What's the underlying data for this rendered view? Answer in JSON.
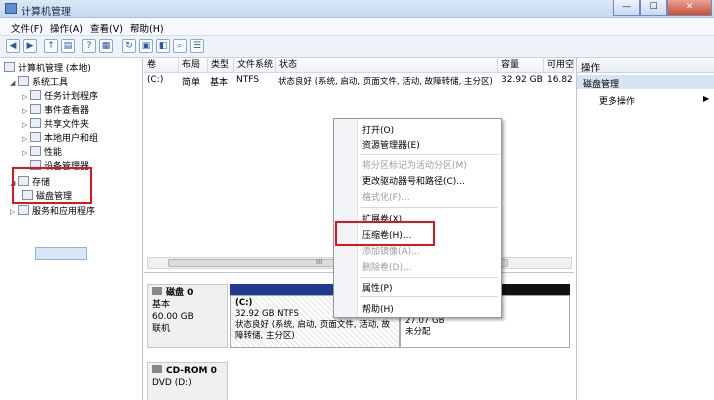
{
  "window": {
    "title": "计算机管理",
    "min": "—",
    "max": "☐",
    "close": "✕"
  },
  "menu": [
    "文件(F)",
    "操作(A)",
    "查看(V)",
    "帮助(H)"
  ],
  "tree": {
    "root": "计算机管理 (本地)",
    "system_tools": "系统工具",
    "task_scheduler": "任务计划程序",
    "event_viewer": "事件查看器",
    "shared_folders": "共享文件夹",
    "local_users": "本地用户和组",
    "performance": "性能",
    "device_manager": "设备管理器",
    "storage": "存储",
    "disk_management": "磁盘管理",
    "services_apps": "服务和应用程序"
  },
  "list": {
    "headers": [
      "卷",
      "布局",
      "类型",
      "文件系统",
      "状态",
      "容量",
      "可用空"
    ],
    "row": [
      "(C:)",
      "简单",
      "基本",
      "NTFS",
      "状态良好 (系统, 启动, 页面文件, 活动, 故障转储, 主分区)",
      "32.92 GB",
      "16.82"
    ],
    "scroll_mark": "III"
  },
  "disks": {
    "disk0": {
      "name": "磁盘 0",
      "type": "基本",
      "size": "60.00 GB",
      "status": "联机"
    },
    "c_part": {
      "label": "(C:)",
      "size": "32.92 GB NTFS",
      "status": "状态良好 (系统, 启动, 页面文件, 活动, 故障转储, 主分区)"
    },
    "unalloc": {
      "size": "27.07 GB",
      "status": "未分配"
    },
    "cdrom": {
      "name": "CD-ROM 0",
      "drive": "DVD (D:)"
    }
  },
  "actions": {
    "header": "操作",
    "section": "磁盘管理",
    "more": "更多操作"
  },
  "context_menu": {
    "open": "打开(O)",
    "explore": "资源管理器(E)",
    "mark_active": "将分区标记为活动分区(M)",
    "change_letter": "更改驱动器号和路径(C)...",
    "format": "格式化(F)...",
    "extend": "扩展卷(X)...",
    "shrink": "压缩卷(H)...",
    "add_mirror": "添加镜像(A)...",
    "delete": "删除卷(D)...",
    "properties": "属性(P)",
    "help": "帮助(H)"
  },
  "colors": {
    "highlight_red": "#e0141e",
    "disk_bar": "#1f3a8f",
    "selection": "#d8e6f8"
  }
}
